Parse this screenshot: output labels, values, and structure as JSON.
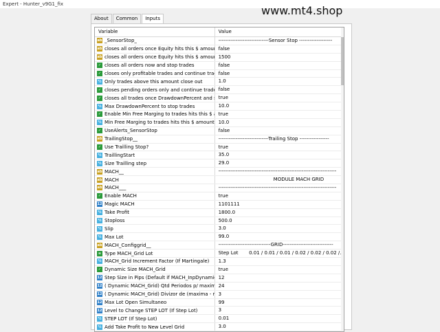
{
  "window": {
    "title": "Expert - Hunter_v9G1_fix"
  },
  "watermark": "www.mt4.shop",
  "tabs": [
    {
      "label": "About",
      "active": false
    },
    {
      "label": "Common",
      "active": false
    },
    {
      "label": "Inputs",
      "active": true
    }
  ],
  "table": {
    "headers": [
      "Variable",
      "Value"
    ],
    "rows": [
      {
        "icon": "ab",
        "name": "_SensorStop_",
        "value": "-----------------------------Sensor Stop -------------------"
      },
      {
        "icon": "ab",
        "name": "closes all orders once Equity hits this $ amount ...",
        "value": "false"
      },
      {
        "icon": "ab",
        "name": "closes all orders once Equity hits this $ amount ...",
        "value": "1500"
      },
      {
        "icon": "bool",
        "name": "closes all orders now and stop trades",
        "value": "false"
      },
      {
        "icon": "bool",
        "name": "closes only profitable trades and continue trade",
        "value": "false"
      },
      {
        "icon": "dbl",
        "name": "Only trades above this amount close out",
        "value": "1.0"
      },
      {
        "icon": "bool",
        "name": "closes pending orders only and continue trade",
        "value": "false"
      },
      {
        "icon": "bool",
        "name": "closes all trades once  DrawdownPercent and st...",
        "value": "true"
      },
      {
        "icon": "dbl",
        "name": "Max  DrawdownPercent to stop trades",
        "value": "10.0"
      },
      {
        "icon": "bool",
        "name": "Enable Min  Free Marging to trades hits this $ a...",
        "value": "true"
      },
      {
        "icon": "dbl",
        "name": "Min  Free Marging to trades hits this $ amount",
        "value": "10.0"
      },
      {
        "icon": "bool",
        "name": "UseAlerts_SensorStop",
        "value": "false"
      },
      {
        "icon": "ab",
        "name": "TrailingStop__",
        "value": "-----------------------------Trailing Stop -----------------"
      },
      {
        "icon": "bool",
        "name": "Use Trailling Stop?",
        "value": "true"
      },
      {
        "icon": "dbl",
        "name": "TraillingStart",
        "value": "35.0"
      },
      {
        "icon": "dbl",
        "name": "Size Trailling step",
        "value": "29.0"
      },
      {
        "icon": "ab",
        "name": "MACH__",
        "value": "--------------------------------------------------------------------"
      },
      {
        "icon": "ab",
        "name": "MACH",
        "value": "                                    MODULE MACH GRID"
      },
      {
        "icon": "ab",
        "name": "MACH___",
        "value": "--------------------------------------------------------------------"
      },
      {
        "icon": "bool",
        "name": "Enable MACH",
        "value": "true"
      },
      {
        "icon": "num",
        "name": "Magic MACH",
        "value": "1101111"
      },
      {
        "icon": "dbl",
        "name": "Take Profit",
        "value": "1800.0"
      },
      {
        "icon": "dbl",
        "name": "Stoploss",
        "value": "500.0"
      },
      {
        "icon": "dbl",
        "name": "Slip",
        "value": "3.0"
      },
      {
        "icon": "dbl",
        "name": "Max Lot",
        "value": "99.0"
      },
      {
        "icon": "ab",
        "name": "MACH_Configgrid__",
        "value": "------------------------------GRID-----------------------------"
      },
      {
        "icon": "enum",
        "name": "Type MACH_Grid Lot",
        "value": "Step Lot       0.01 / 0.01 / 0.01 / 0.02 / 0.02 / 0.02 /..."
      },
      {
        "icon": "dbl",
        "name": "MACH_Grid Increment Factor (If Martingale)",
        "value": "1.3"
      },
      {
        "icon": "bool",
        "name": "Dynamic Size MACH_Grid",
        "value": "true"
      },
      {
        "icon": "num",
        "name": "Step Size in Pips (Default if MACH_InpDynamicSi...",
        "value": "12"
      },
      {
        "icon": "num",
        "name": "( Dynamic MACH_Grid) Qtd Periodos p/ maxima...",
        "value": "24"
      },
      {
        "icon": "num",
        "name": "( Dynamic MACH_Grid) Divizor de (maxima - min...",
        "value": "3"
      },
      {
        "icon": "num",
        "name": "Max Lot Open Simultaneo",
        "value": "99"
      },
      {
        "icon": "num",
        "name": "Level to Change STEP LOT (If  Step Lot)",
        "value": "3"
      },
      {
        "icon": "dbl",
        "name": "STEP LOT (If  Step Lot)",
        "value": "0.01"
      },
      {
        "icon": "dbl",
        "name": "Add Take Profit to New Level Grid",
        "value": "3.0"
      }
    ]
  },
  "icons": {
    "ab": "string-param-icon",
    "bool": "bool-param-icon",
    "num": "int-param-icon",
    "dbl": "double-param-icon",
    "enum": "enum-param-icon"
  },
  "icon_glyphs": {
    "ab": "ab",
    "bool": "✓",
    "num": "12",
    "dbl": "½",
    "enum": "≡"
  },
  "colors": {
    "string_icon": "#c8a020",
    "bool_icon": "#2a9a3a",
    "int_icon": "#2f80c8",
    "double_icon": "#45b0e0"
  }
}
